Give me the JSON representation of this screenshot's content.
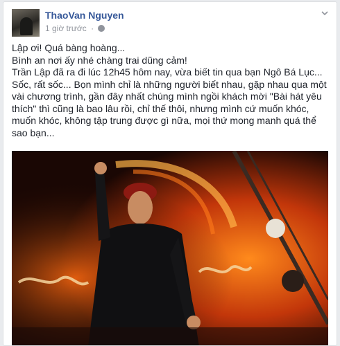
{
  "post": {
    "author": "ThaoVan Nguyen",
    "time": "1 giờ trước",
    "separator": "·",
    "paragraphs": [
      "Lập ơi! Quá bàng hoàng...",
      "Bình an nơi ấy nhé chàng trai dũng cảm!",
      "Trần Lập đã ra đi lúc 12h45 hôm nay, vừa biết tin qua bạn Ngô Bá Lục... Sốc, rất sốc... Bọn mình chỉ là những người biết nhau, gặp nhau qua một vài chương trình, gần đây nhất chúng mình ngồi khách mời \"Bài hát yêu thích\" thì cũng là bao lâu rồi, chỉ thế thôi, nhưng mình cứ muốn khóc, muốn khóc, không tập trung được gì nữa, mọi thứ mong manh quá thể sao bạn..."
    ]
  },
  "icons": {
    "globe": "globe-icon",
    "options": "chevron-down-icon"
  },
  "colors": {
    "link": "#365899",
    "meta": "#90949c",
    "text": "#1d2129"
  }
}
